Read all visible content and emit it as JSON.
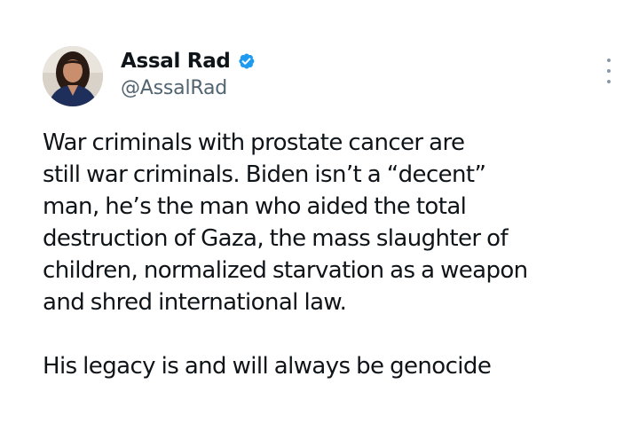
{
  "author": {
    "display_name": "Assal Rad",
    "handle": "@AssalRad",
    "verified": true,
    "verified_color": "#1d9bf0",
    "avatar_icon": "profile-photo"
  },
  "menu": {
    "icon": "more-options-icon"
  },
  "tweet": {
    "paragraph_1": [
      "War criminals with prostate cancer are",
      "still war criminals. Biden isn’t a “decent”",
      "man, he’s the man who aided the total",
      "destruction of Gaza, the mass slaughter of",
      "children, normalized starvation as a weapon",
      "and shred international law."
    ],
    "paragraph_2": [
      "His legacy is and will always be genocide"
    ]
  }
}
